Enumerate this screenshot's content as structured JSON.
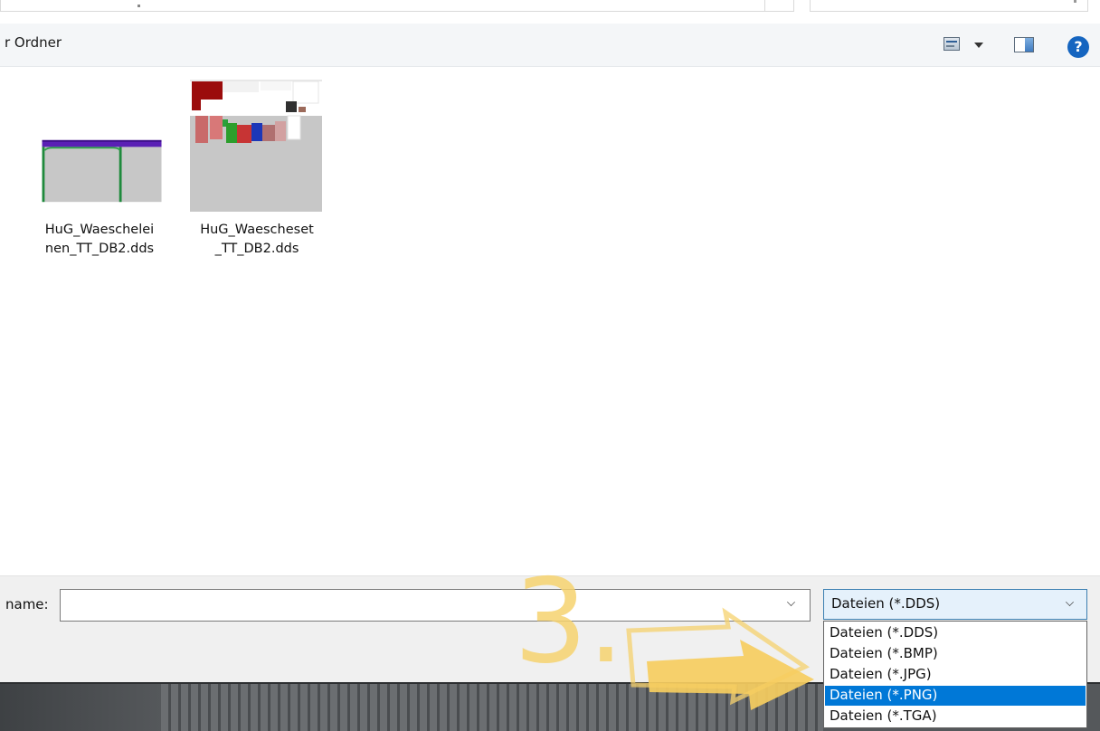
{
  "toolbar": {
    "new_folder_label": "r Ordner",
    "help_glyph": "?"
  },
  "files": [
    {
      "name_line1": "HuG_Waeschelei",
      "name_line2": "nen_TT_DB2.dds"
    },
    {
      "name_line1": "HuG_Waescheset",
      "name_line2": "_TT_DB2.dds"
    }
  ],
  "filename": {
    "label": "name:",
    "value": ""
  },
  "filetype": {
    "selected_value": "Dateien (*.DDS)",
    "options": [
      "Dateien (*.DDS)",
      "Dateien (*.BMP)",
      "Dateien (*.JPG)",
      "Dateien (*.PNG)",
      "Dateien (*.TGA)"
    ],
    "highlighted_option": "Dateien (*.PNG)"
  },
  "annotation": {
    "step_number": "3.",
    "color": "#f6d26e"
  },
  "colors": {
    "selection": "#0078d7",
    "help": "#1565c0",
    "command_bar": "#f4f6f8",
    "bottom_panel": "#f0f0f0"
  }
}
